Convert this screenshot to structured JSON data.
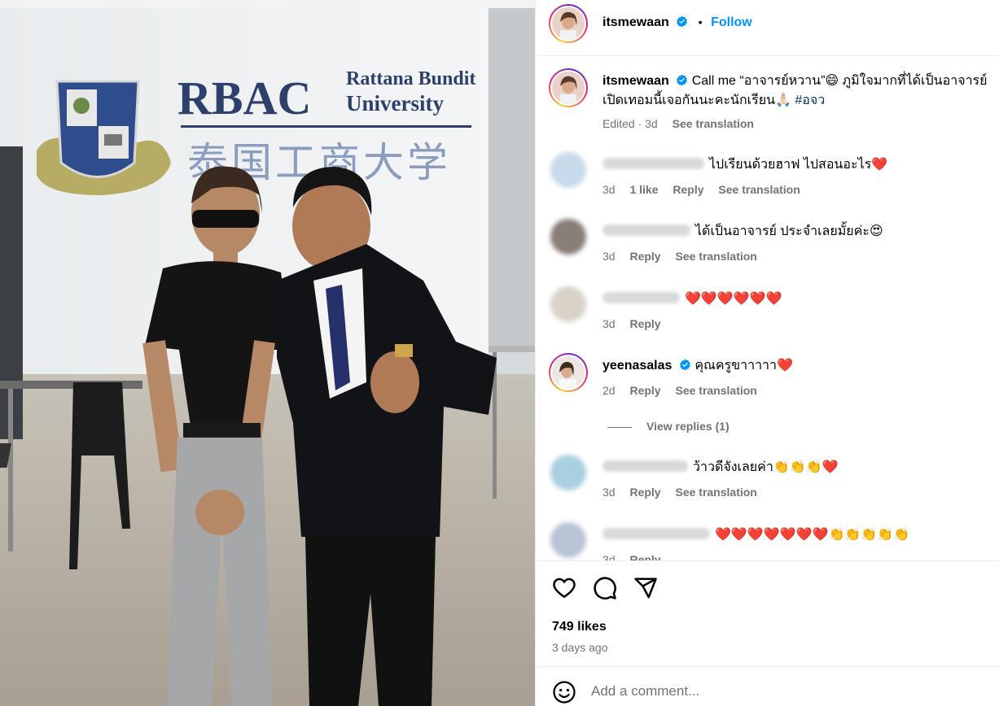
{
  "post_author": {
    "username": "itsmewaan",
    "follow_label": "Follow",
    "separator": "•"
  },
  "caption": {
    "username": "itsmewaan",
    "line1": "Call me “อาจารย์หวาน”😄 ภูมิใจมากที่ได้เป็นอาจารย์",
    "line2": "เปิดเทอมนี้เจอกันนะคะนักเรียน🙏🏻 ",
    "hashtag": "#อจว",
    "meta_edited": "Edited · 3d",
    "meta_translate": "See translation"
  },
  "comments": [
    {
      "text": "ไปเรียนด้วยฮาฟ ไปสอนอะไร❤️",
      "time": "3d",
      "likes": "1 like",
      "reply": "Reply",
      "translate": "See translation"
    },
    {
      "text": "ได้เป็นอาจารย์ ประจำเลยมั้ยค่ะ😍",
      "time": "3d",
      "reply": "Reply",
      "translate": "See translation"
    },
    {
      "text": "❤️❤️❤️❤️❤️❤️",
      "time": "3d",
      "reply": "Reply"
    },
    {
      "username": "yeenasalas",
      "text": "คุณครูขาาาาา❤️",
      "time": "2d",
      "reply": "Reply",
      "translate": "See translation",
      "view_replies": "View replies (1)"
    },
    {
      "text": "ว้าวดีจังเลยค่า👏👏👏❤️",
      "time": "3d",
      "reply": "Reply",
      "translate": "See translation"
    },
    {
      "text": "❤️❤️❤️❤️❤️❤️❤️👏👏👏👏👏",
      "time": "3d",
      "reply": "Reply"
    }
  ],
  "actions": {
    "likes": "749 likes",
    "time_ago": "3 days ago",
    "icons": [
      "heart-icon",
      "comment-icon",
      "share-icon"
    ]
  },
  "add_comment": {
    "placeholder": "Add a comment..."
  },
  "photo": {
    "sign_title": "RBAC",
    "sign_line1": "Rattana Bundit",
    "sign_line2": "University",
    "sign_chinese": "泰国工商大学",
    "seal_text": "RATTANA BUNDIT UNIVERSITY"
  },
  "colors": {
    "accent": "#0095f6",
    "muted": "#737373",
    "hashtag": "#00376b"
  }
}
